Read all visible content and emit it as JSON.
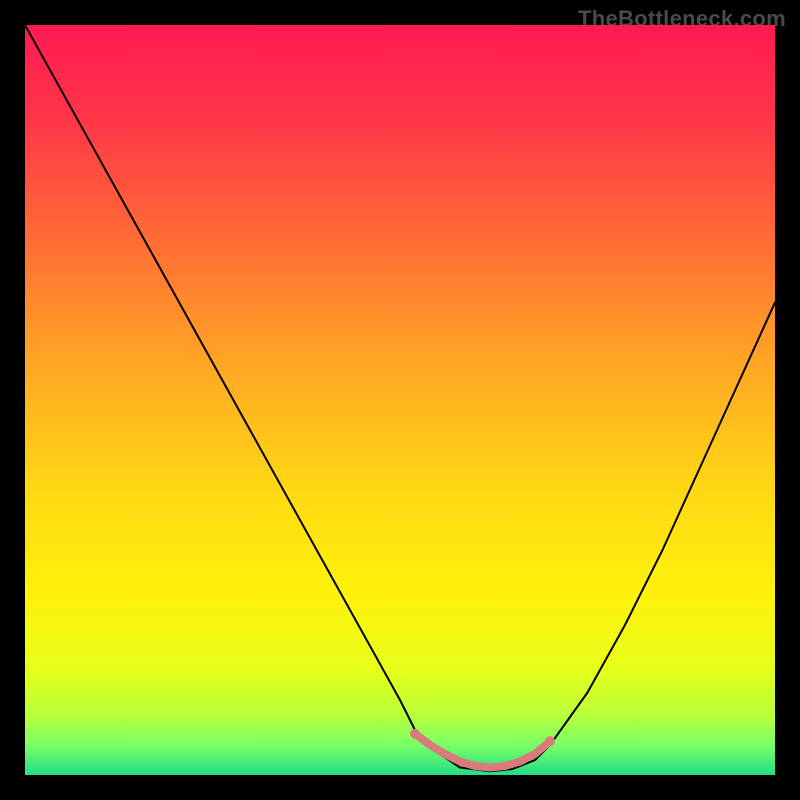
{
  "watermark": "TheBottleneck.com",
  "chart_data": {
    "type": "line",
    "title": "",
    "xlabel": "",
    "ylabel": "",
    "xlim": [
      0,
      100
    ],
    "ylim": [
      0,
      100
    ],
    "grid": false,
    "legend": false,
    "background_gradient": {
      "stops": [
        {
          "offset": 0.0,
          "color": "#ff1a53"
        },
        {
          "offset": 0.12,
          "color": "#ff3448"
        },
        {
          "offset": 0.28,
          "color": "#ff6a36"
        },
        {
          "offset": 0.45,
          "color": "#ffa624"
        },
        {
          "offset": 0.62,
          "color": "#ffd814"
        },
        {
          "offset": 0.76,
          "color": "#fff20a"
        },
        {
          "offset": 0.86,
          "color": "#e6ff1a"
        },
        {
          "offset": 0.92,
          "color": "#b8ff3a"
        },
        {
          "offset": 0.96,
          "color": "#7aff66"
        },
        {
          "offset": 1.0,
          "color": "#22dd88"
        }
      ]
    },
    "series": [
      {
        "name": "bottleneck-curve",
        "stroke": "#000000",
        "stroke_width": 2,
        "x": [
          0,
          5,
          10,
          15,
          20,
          25,
          30,
          35,
          40,
          45,
          50,
          52,
          55,
          58,
          62,
          65,
          68,
          70,
          75,
          80,
          85,
          90,
          95,
          100
        ],
        "y": [
          100,
          91,
          82,
          73,
          64,
          55,
          46,
          37,
          28,
          19,
          10,
          6,
          3,
          1,
          0.5,
          0.8,
          2,
          4,
          11,
          20,
          30,
          41,
          52,
          63
        ]
      },
      {
        "name": "flat-zone-marker",
        "stroke": "#d97b7b",
        "stroke_width": 8,
        "x": [
          52,
          54,
          56,
          58,
          60,
          62,
          64,
          66,
          68,
          70
        ],
        "y": [
          5.5,
          4.0,
          2.8,
          1.8,
          1.2,
          1.0,
          1.2,
          1.8,
          2.8,
          4.5
        ]
      }
    ],
    "markers": [
      {
        "name": "flat-start-dot",
        "x": 52,
        "y": 5.5,
        "r": 5,
        "color": "#d97b7b"
      },
      {
        "name": "flat-end-dot",
        "x": 70,
        "y": 4.5,
        "r": 5,
        "color": "#d97b7b"
      }
    ]
  }
}
